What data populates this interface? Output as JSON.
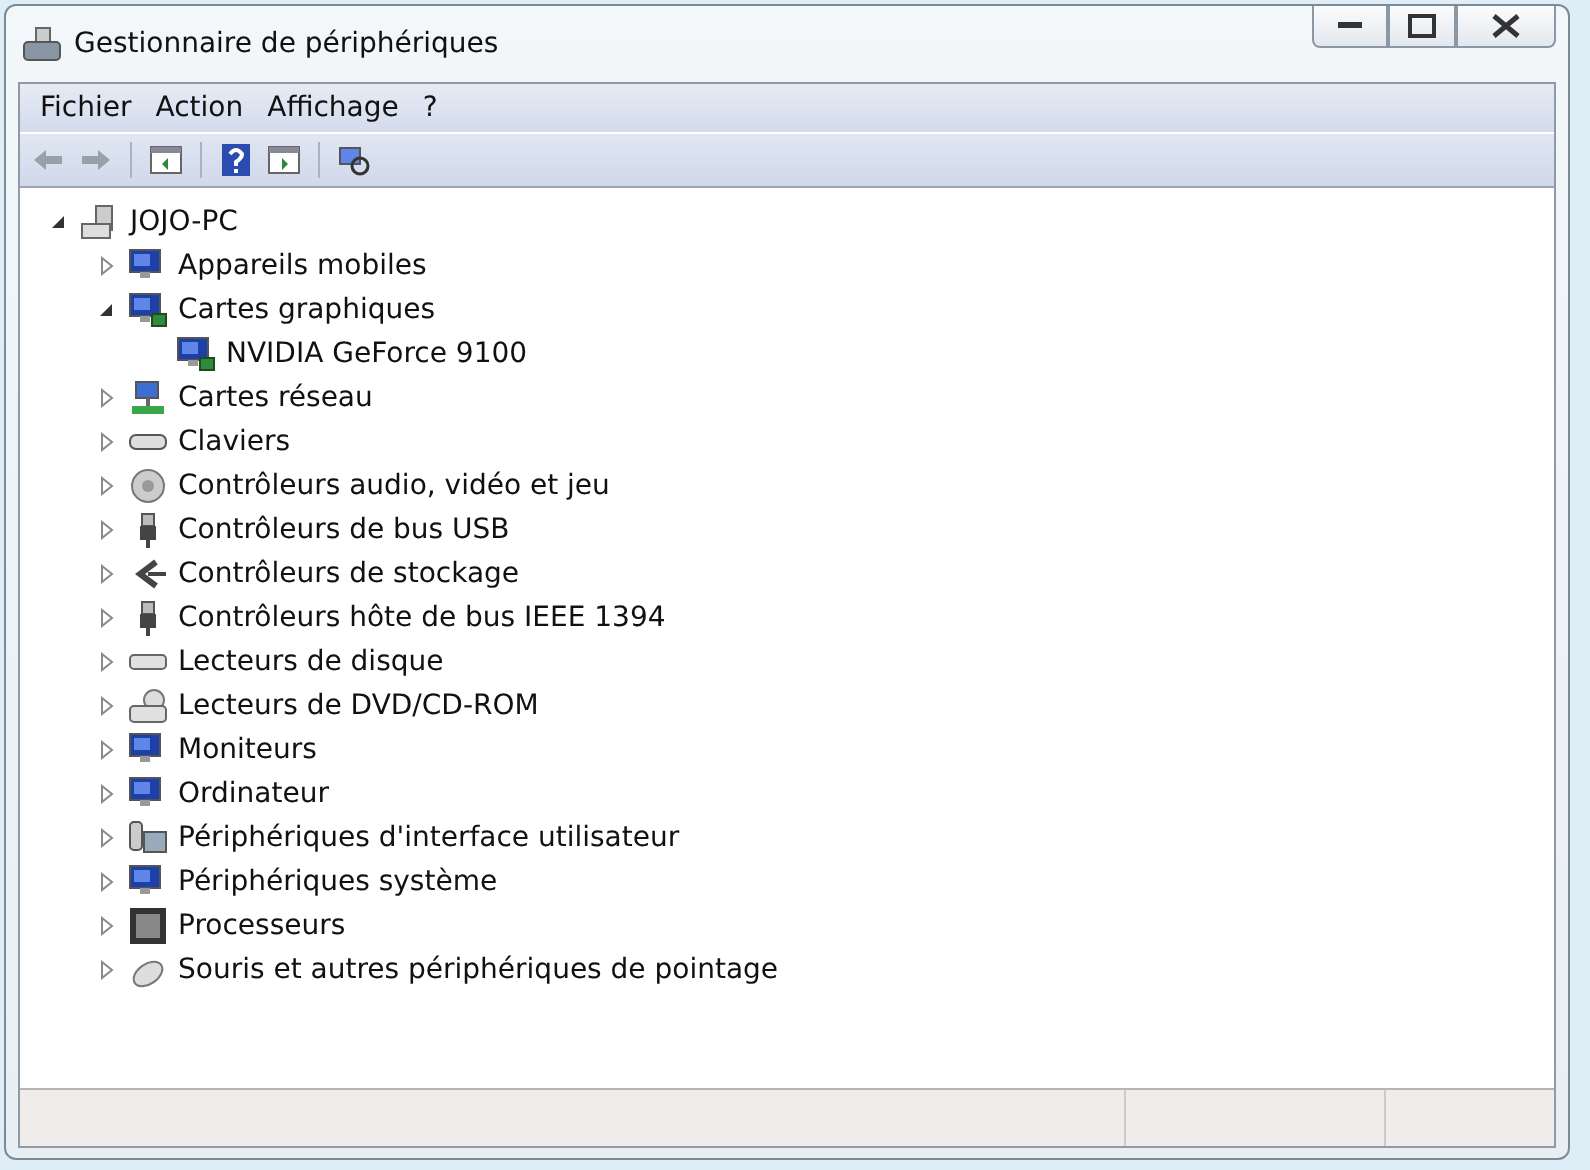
{
  "window": {
    "title": "Gestionnaire de périphériques"
  },
  "menu": [
    "Fichier",
    "Action",
    "Affichage",
    "?"
  ],
  "tree": {
    "label": "JOJO-PC",
    "expanded": true,
    "children": [
      {
        "label": "Appareils mobiles",
        "expanded": false
      },
      {
        "label": "Cartes graphiques",
        "expanded": true,
        "children": [
          {
            "label": "NVIDIA GeForce 9100"
          }
        ]
      },
      {
        "label": "Cartes réseau",
        "expanded": false
      },
      {
        "label": "Claviers",
        "expanded": false
      },
      {
        "label": "Contrôleurs audio, vidéo et jeu",
        "expanded": false
      },
      {
        "label": "Contrôleurs de bus USB",
        "expanded": false
      },
      {
        "label": "Contrôleurs de stockage",
        "expanded": false
      },
      {
        "label": "Contrôleurs hôte de bus IEEE 1394",
        "expanded": false
      },
      {
        "label": "Lecteurs de disque",
        "expanded": false
      },
      {
        "label": "Lecteurs de DVD/CD-ROM",
        "expanded": false
      },
      {
        "label": "Moniteurs",
        "expanded": false
      },
      {
        "label": "Ordinateur",
        "expanded": false
      },
      {
        "label": "Périphériques d'interface utilisateur",
        "expanded": false
      },
      {
        "label": "Périphériques système",
        "expanded": false
      },
      {
        "label": "Processeurs",
        "expanded": false
      },
      {
        "label": "Souris et autres périphériques de pointage",
        "expanded": false
      }
    ]
  }
}
